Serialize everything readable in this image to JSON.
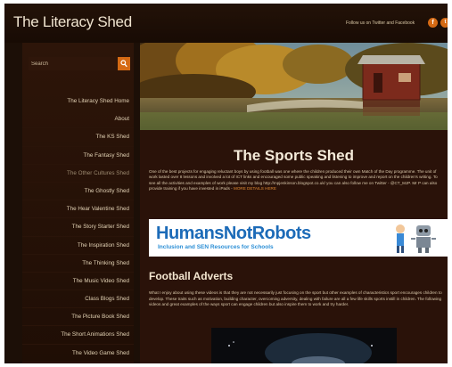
{
  "header": {
    "site_title": "The Literacy Shed",
    "follow_text": "Follow us on Twitter and Facebook",
    "social_icons": [
      "facebook-icon",
      "twitter-icon"
    ]
  },
  "sidebar": {
    "search_placeholder": "Search",
    "search_icon": "search-icon",
    "items": [
      {
        "label": "The Literacy Shed Home"
      },
      {
        "label": "About"
      },
      {
        "label": "The KS Shed"
      },
      {
        "label": "The Fantasy Shed"
      },
      {
        "label": "The Other Cultures Shed"
      },
      {
        "label": "The Ghostly Shed"
      },
      {
        "label": "The Hear Valentine Shed"
      },
      {
        "label": "The Story Starter Shed"
      },
      {
        "label": "The Inspiration Shed"
      },
      {
        "label": "The Thinking Shed"
      },
      {
        "label": "The Music Video Shed"
      },
      {
        "label": "Class Blogs Shed"
      },
      {
        "label": "The Picture Book Shed"
      },
      {
        "label": "The Short Animations Shed"
      },
      {
        "label": "The Video Game Shed"
      }
    ]
  },
  "main": {
    "title": "The Sports Shed",
    "intro": "One of the best projects for engaging reluctant boys by using football was one where the children produced their own Match of the Day programme. The unit of work lasted over 8 lessons and involved a lot of ICT links and encouraged some public speaking and listening to improve and report on the children's writing. To see all the activities and examples of work please visit my blog http://mpjenkinson.blogspot.co.uk/ you can also follow me on Twitter - @CT_MJP. Mr P can also provide training if you have invested in iPads -",
    "intro_more": "MORE DETAILS HERE",
    "banner": {
      "title": "HumansNotRobots",
      "subtitle": "Inclusion and SEN Resources for Schools"
    },
    "section_heading": "Football Adverts",
    "section_text": "What I enjoy about using these videos is that they are not necessarily just focusing on the sport but other examples of characteristics sport encourages children to develop. These traits such as motivation, building character, overcoming adversity, dealing with failure are all a few life skills sports instill in children. The following videos and great examples of the ways sport can engage children but also inspire them to work and try harder."
  },
  "colors": {
    "accent": "#d56a14",
    "background": "#1c0f07",
    "banner_blue": "#1c6bb8"
  }
}
